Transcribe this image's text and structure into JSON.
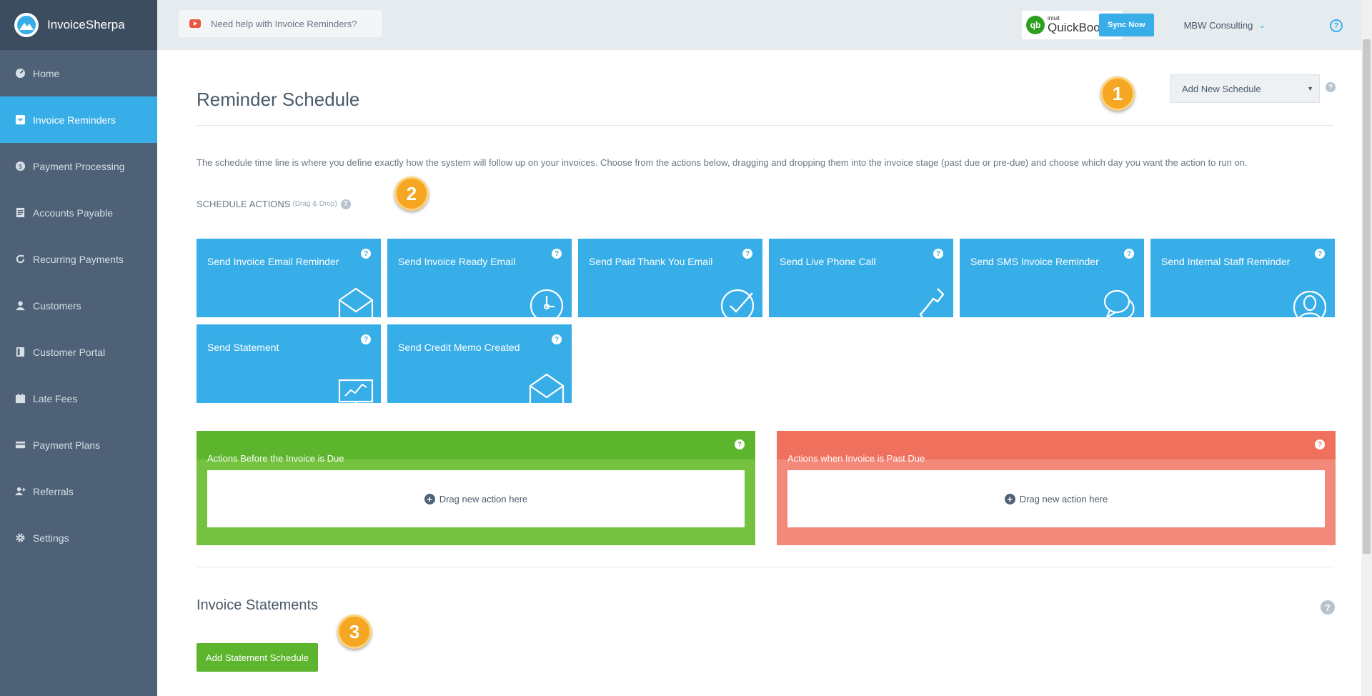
{
  "app": {
    "name": "InvoiceSherpa"
  },
  "sidebar": {
    "items": [
      {
        "label": "Home",
        "icon": "dashboard-icon",
        "active": false
      },
      {
        "label": "Invoice Reminders",
        "icon": "inbox-icon",
        "active": true
      },
      {
        "label": "Payment Processing",
        "icon": "dollar-icon",
        "active": false
      },
      {
        "label": "Accounts Payable",
        "icon": "document-icon",
        "active": false
      },
      {
        "label": "Recurring Payments",
        "icon": "refresh-icon",
        "active": false
      },
      {
        "label": "Customers",
        "icon": "user-icon",
        "active": false
      },
      {
        "label": "Customer Portal",
        "icon": "portal-icon",
        "active": false
      },
      {
        "label": "Late Fees",
        "icon": "calendar-icon",
        "active": false
      },
      {
        "label": "Payment Plans",
        "icon": "card-icon",
        "active": false
      },
      {
        "label": "Referrals",
        "icon": "add-user-icon",
        "active": false
      },
      {
        "label": "Settings",
        "icon": "gear-icon",
        "active": false
      }
    ]
  },
  "topbar": {
    "help_text": "Need help with Invoice Reminders?",
    "qb_intuit": "intuit",
    "qb_name": "QuickBooks",
    "qb_logo_mark": "qb",
    "sync_label": "Sync Now",
    "account_name": "MBW Consulting",
    "help_icon": "?"
  },
  "main": {
    "title": "Reminder Schedule",
    "schedule_select": "Add New Schedule",
    "intro": "The schedule time line is where you define exactly how the system will follow up on your invoices. Choose from the actions below, dragging and dropping them into the invoice stage (past due or pre-due) and choose which day you want the action to run on.",
    "actions_heading": "SCHEDULE ACTIONS",
    "actions_hint": "(Drag & Drop)",
    "markers": [
      "1",
      "2",
      "3"
    ],
    "tiles": [
      {
        "label": "Send Invoice Email Reminder",
        "icon": "envelope-icon"
      },
      {
        "label": "Send Invoice Ready Email",
        "icon": "clock-icon"
      },
      {
        "label": "Send Paid Thank You Email",
        "icon": "check-circle-icon"
      },
      {
        "label": "Send Live Phone Call",
        "icon": "phone-icon"
      },
      {
        "label": "Send SMS Invoice Reminder",
        "icon": "chat-bubble-icon"
      },
      {
        "label": "Send Internal Staff Reminder",
        "icon": "person-icon"
      },
      {
        "label": "Send Statement",
        "icon": "presentation-chart-icon"
      },
      {
        "label": "Send Credit Memo Created",
        "icon": "envelope-icon"
      }
    ],
    "stages": {
      "before": {
        "label": "Actions Before the Invoice is Due",
        "drop_text": "Drag new action here",
        "color": "#5cb52c"
      },
      "past": {
        "label": "Actions when Invoice is Past Due",
        "drop_text": "Drag new action here",
        "color": "#f0705e"
      }
    },
    "statements_title": "Invoice Statements",
    "add_statement_label": "Add Statement Schedule",
    "help_glyph": "?",
    "plus_glyph": "+"
  },
  "colors": {
    "accent": "#38aee8",
    "sidebar": "#4e6176",
    "green": "#5cb52c",
    "red": "#f0705e",
    "marker": "#f5a623"
  }
}
